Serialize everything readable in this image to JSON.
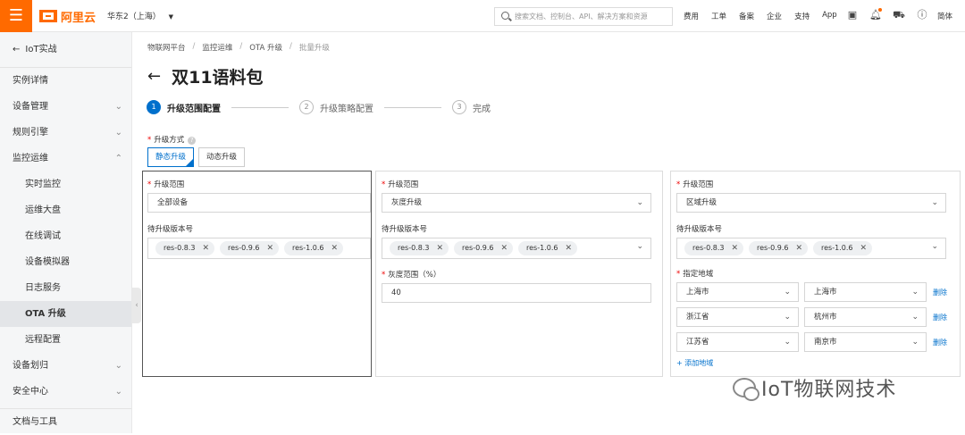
{
  "topbar": {
    "brand": "阿里云",
    "region": "华东2（上海）",
    "search_placeholder": "搜索文档、控制台、API、解决方案和资源",
    "links": [
      "费用",
      "工单",
      "备案",
      "企业",
      "支持",
      "App"
    ],
    "lang": "简体",
    "accent": "#ff6a00"
  },
  "sidebar": {
    "back_label": "IoT实战",
    "items": [
      {
        "label": "实例详情"
      },
      {
        "label": "设备管理"
      },
      {
        "label": "规则引擎"
      },
      {
        "label": "监控运维"
      },
      {
        "label": "实时监控"
      },
      {
        "label": "运维大盘"
      },
      {
        "label": "在线调试"
      },
      {
        "label": "设备模拟器"
      },
      {
        "label": "日志服务"
      },
      {
        "label": "OTA 升级"
      },
      {
        "label": "远程配置"
      },
      {
        "label": "设备划归"
      },
      {
        "label": "安全中心"
      },
      {
        "label": "文档与工具"
      }
    ]
  },
  "breadcrumb": [
    "物联网平台",
    "监控运维",
    "OTA 升级",
    "批量升级"
  ],
  "page": {
    "title": "双11语料包"
  },
  "steps": [
    {
      "num": "1",
      "label": "升级范围配置"
    },
    {
      "num": "2",
      "label": "升级策略配置"
    },
    {
      "num": "3",
      "label": "完成"
    }
  ],
  "mode": {
    "label": "升级方式",
    "options": [
      "静态升级",
      "动态升级"
    ]
  },
  "panel1": {
    "scope_label": "升级范围",
    "scope_value": "全部设备",
    "version_label": "待升级版本号",
    "versions": [
      "res-0.8.3",
      "res-0.9.6",
      "res-1.0.6"
    ]
  },
  "panel2": {
    "scope_label": "升级范围",
    "scope_value": "灰度升级",
    "version_label": "待升级版本号",
    "versions": [
      "res-0.8.3",
      "res-0.9.6",
      "res-1.0.6"
    ],
    "gray_label": "灰度范围（%）",
    "gray_value": "40"
  },
  "panel3": {
    "scope_label": "升级范围",
    "scope_value": "区域升级",
    "version_label": "待升级版本号",
    "versions": [
      "res-0.8.3",
      "res-0.9.6",
      "res-1.0.6"
    ],
    "region_label": "指定地域",
    "regions": [
      {
        "province": "上海市",
        "city": "上海市"
      },
      {
        "province": "浙江省",
        "city": "杭州市"
      },
      {
        "province": "江苏省",
        "city": "南京市"
      }
    ],
    "delete_label": "删除",
    "add_label": "+ 添加地域"
  },
  "watermark": "IoT物联网技术"
}
